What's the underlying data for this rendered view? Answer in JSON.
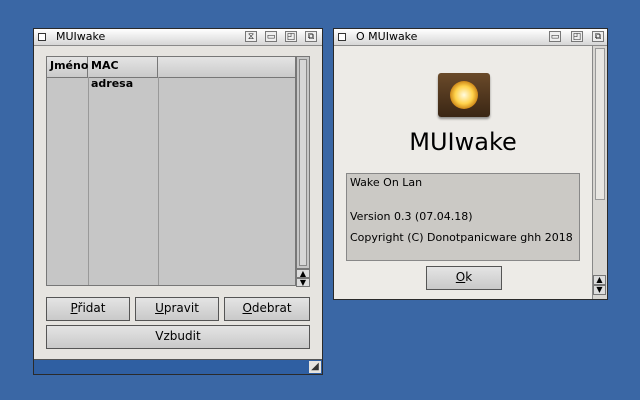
{
  "colors": {
    "desktop": "#3a67a5",
    "panel": "#e6e4e0",
    "list": "#c6c6c6"
  },
  "main_window": {
    "title": "MUIwake",
    "columns": [
      "Jméno",
      "MAC adresa",
      ""
    ],
    "buttons": {
      "add": {
        "pre": "",
        "u": "P",
        "post": "řidat"
      },
      "edit": {
        "pre": "",
        "u": "U",
        "post": "pravit"
      },
      "remove": {
        "pre": "",
        "u": "O",
        "post": "debrat"
      },
      "wake": "Vzbudit"
    }
  },
  "about_window": {
    "title": "O MUIwake",
    "app_name": "MUIwake",
    "lines": [
      "Wake On Lan",
      "",
      "Version 0.3 (07.04.18)",
      "Copyright (C) Donotpanicware ghh 2018"
    ],
    "ok": {
      "pre": "",
      "u": "O",
      "post": "k"
    }
  },
  "icons": {
    "close": "close-icon",
    "iconify": "iconify-icon",
    "zoom": "zoom-icon",
    "depth": "depth-icon",
    "app": "lamp-icon",
    "resize": "resize-icon"
  }
}
